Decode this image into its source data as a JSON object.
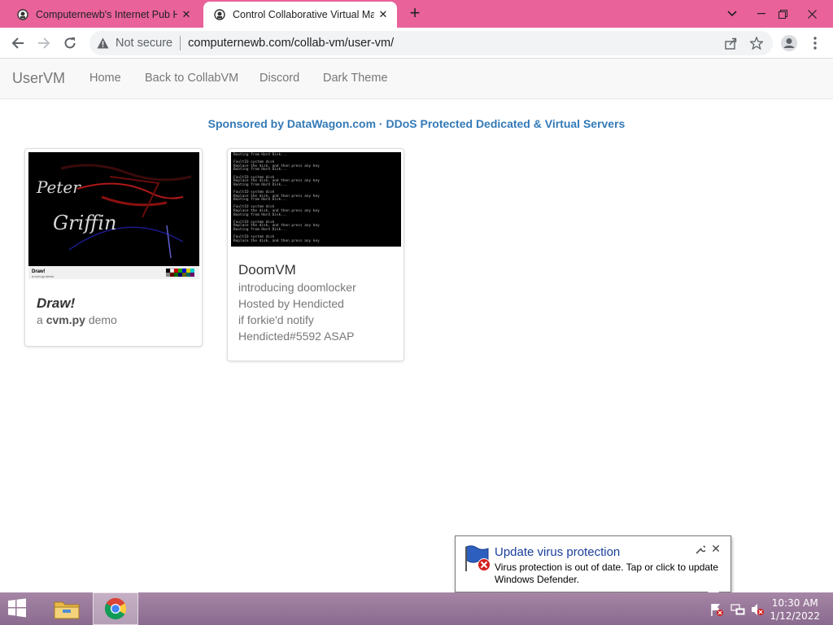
{
  "browser": {
    "tabs": [
      {
        "title": "Computernewb's Internet Pub Hub",
        "favicon": "computernewb-favicon"
      },
      {
        "title": "Control Collaborative Virtual Machines",
        "favicon": "computernewb-favicon"
      }
    ],
    "new_tab": "+",
    "address": {
      "security_label": "Not secure",
      "url": "computernewb.com/collab-vm/user-vm/"
    }
  },
  "site": {
    "brand": "UserVM",
    "nav": [
      "Home",
      "Back to CollabVM",
      "Discord",
      "Dark Theme"
    ],
    "sponsor": "Sponsored by DataWagon.com · DDoS Protected Dedicated & Virtual Servers",
    "vms": [
      {
        "title": "Draw!",
        "desc_prefix": "a ",
        "desc_bold": "cvm.py",
        "desc_suffix": " demo",
        "thumb": {
          "handwriting": [
            "Peter",
            "Griffin"
          ],
          "caption_title": "Draw!",
          "caption_sub": "a cvm.py demo"
        }
      },
      {
        "title": "DoomVM",
        "desc_lines": [
          "introducing doomlocker",
          "Hosted by Hendicted",
          "if forkie'd notify",
          "Hendicted#5592 ASAP"
        ],
        "thumb": {
          "console_lines": [
            "Booting from Hard Disk...",
            "",
            "FaultIO system disk",
            "Replace the disk, and then press any key",
            "Booting from Hard Disk...",
            "",
            "FaultIO system disk",
            "Replace the disk, and then press any key",
            "Booting from Hard Disk...",
            "",
            "FaultIO system disk",
            "Replace the disk, and then press any key",
            "Booting from Hard Disk...",
            "",
            "FaultIO system disk",
            "Replace the disk, and then press any key",
            "Booting from Hard Disk...",
            "",
            "FaultIO system disk",
            "Replace the disk, and then press any key",
            "Booting from Hard Disk...",
            "",
            "FaultIO system disk",
            "Replace the disk, and then press any key"
          ]
        }
      }
    ]
  },
  "notification": {
    "title": "Update virus protection",
    "text": "Virus protection is out of date. Tap or click to update Windows Defender."
  },
  "taskbar": {
    "apps": [
      "file-explorer",
      "google-chrome"
    ],
    "time": "10:30 AM",
    "date": "1/12/2022"
  },
  "colors": {
    "tabstrip": "#e9629a",
    "link": "#337ab7",
    "balloon_title": "#1a3e9c"
  }
}
